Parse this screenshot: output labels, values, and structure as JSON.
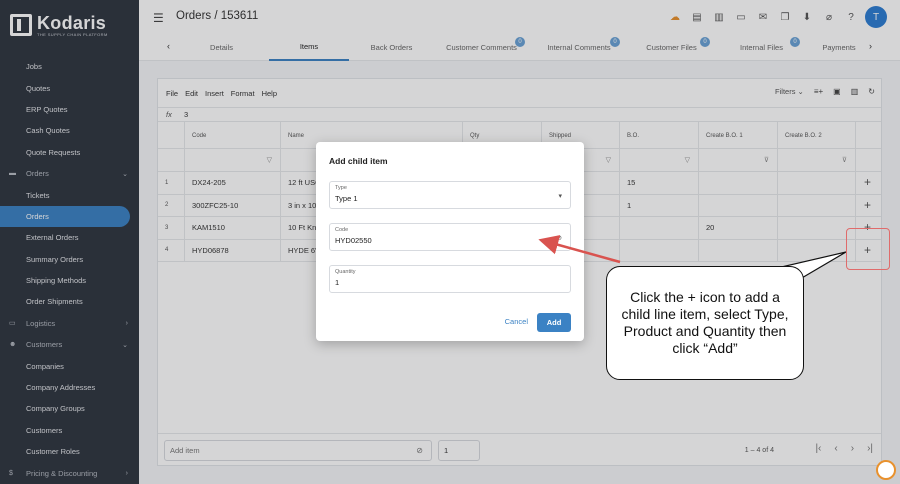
{
  "brand": {
    "name": "Kodaris",
    "tagline": "THE SUPPLY CHAIN PLATFORM"
  },
  "sidebar": {
    "items": [
      {
        "label": "Jobs",
        "type": "item"
      },
      {
        "label": "Quotes",
        "type": "item"
      },
      {
        "label": "ERP Quotes",
        "type": "item"
      },
      {
        "label": "Cash Quotes",
        "type": "item"
      },
      {
        "label": "Quote Requests",
        "type": "item"
      },
      {
        "label": "Orders",
        "type": "section",
        "chevron": "⌄"
      },
      {
        "label": "Tickets",
        "type": "item"
      },
      {
        "label": "Orders",
        "type": "item",
        "active": true
      },
      {
        "label": "External Orders",
        "type": "item"
      },
      {
        "label": "Summary Orders",
        "type": "item"
      },
      {
        "label": "Shipping Methods",
        "type": "item"
      },
      {
        "label": "Order Shipments",
        "type": "item"
      },
      {
        "label": "Logistics",
        "type": "section",
        "chevron": "›"
      },
      {
        "label": "Customers",
        "type": "section",
        "chevron": "⌄"
      },
      {
        "label": "Companies",
        "type": "item"
      },
      {
        "label": "Company Addresses",
        "type": "item"
      },
      {
        "label": "Company Groups",
        "type": "item"
      },
      {
        "label": "Customers",
        "type": "item"
      },
      {
        "label": "Customer Roles",
        "type": "item"
      },
      {
        "label": "Pricing & Discounting",
        "type": "section",
        "chevron": "›"
      }
    ]
  },
  "header": {
    "title": "Orders / 153611",
    "avatar_initial": "T"
  },
  "tabs": [
    {
      "label": "Details"
    },
    {
      "label": "Items",
      "active": true
    },
    {
      "label": "Back Orders"
    },
    {
      "label": "Customer Comments",
      "badge": "0"
    },
    {
      "label": "Internal Comments",
      "badge": "0"
    },
    {
      "label": "Customer Files",
      "badge": "0"
    },
    {
      "label": "Internal Files",
      "badge": "0"
    },
    {
      "label": "Payments"
    }
  ],
  "grid": {
    "menu": [
      "File",
      "Edit",
      "Insert",
      "Format",
      "Help"
    ],
    "filters_label": "Filters",
    "fx_label": "fx",
    "fx_value": "3",
    "columns": [
      "Code",
      "Name",
      "Qty",
      "Shipped",
      "B.O.",
      "Create B.O. 1",
      "Create B.O. 2"
    ],
    "rows": [
      {
        "num": "1",
        "code": "DX24-205",
        "name": "12 ft USC",
        "bo": "15",
        "bo1": ""
      },
      {
        "num": "2",
        "code": "300ZFC25-10",
        "name": "3 in x 10",
        "bo": "1",
        "bo1": ""
      },
      {
        "num": "3",
        "code": "KAM1510",
        "name": "10 Ft Knu",
        "bo": "",
        "bo1": "20"
      },
      {
        "num": "4",
        "code": "HYD06878",
        "name": "HYDE 6\"",
        "bo": "",
        "bo1": ""
      }
    ],
    "add_item_placeholder": "Add item",
    "add_qty": "1",
    "pager_text": "1 – 4 of 4"
  },
  "dialog": {
    "title": "Add child item",
    "type_label": "Type",
    "type_value": "Type 1",
    "code_label": "Code",
    "code_value": "HYD02550",
    "qty_label": "Quantity",
    "qty_value": "1",
    "cancel": "Cancel",
    "add": "Add"
  },
  "callout": {
    "text": "Click the + icon to add a child line item, select Type, Product and Quantity then click “Add”"
  },
  "colors": {
    "accent": "#3b82c4",
    "sidebar_bg": "#2f3640",
    "highlight": "#e06b6b",
    "callout_arrow": "#d9534f"
  }
}
